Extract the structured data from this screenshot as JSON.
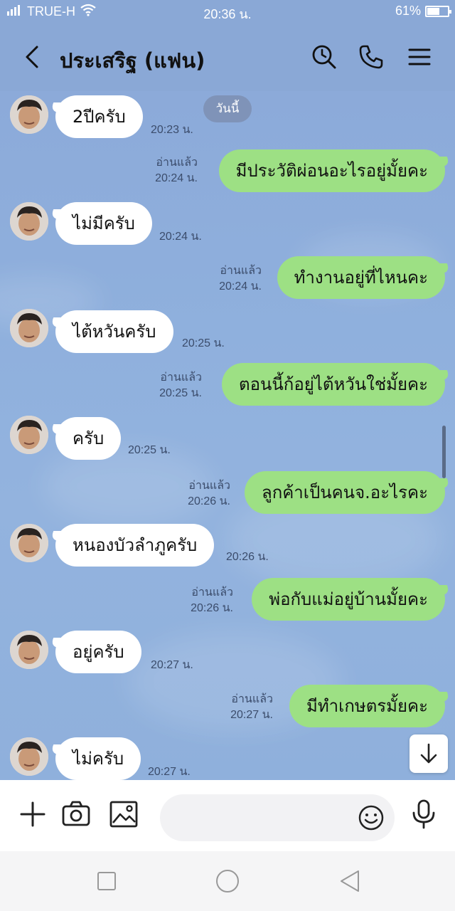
{
  "status_bar": {
    "carrier": "TRUE-H",
    "time": "20:36 น.",
    "battery": "61%",
    "battery_level": 0.61
  },
  "header": {
    "title": "ประเสริฐ (แฟน)"
  },
  "chat": {
    "date_label": "วันนี้",
    "read_label": "อ่านแล้ว",
    "messages": [
      {
        "text": "2ปีครับ",
        "time": "20:23 น."
      },
      {
        "text": "มีประวัติผ่อนอะไรอยู่มั้ยคะ",
        "time": "20:24 น."
      },
      {
        "text": "ไม่มีครับ",
        "time": "20:24 น."
      },
      {
        "text": "ทำงานอยู่ที่ไหนคะ",
        "time": "20:24 น."
      },
      {
        "text": "ไต้หวันครับ",
        "time": "20:25 น."
      },
      {
        "text": "ตอนนี้ก้อยู่ไต้หวันใช่มั้ยคะ",
        "time": "20:25 น."
      },
      {
        "text": "ครับ",
        "time": "20:25 น."
      },
      {
        "text": "ลูกค้าเป็นคนจ.อะไรคะ",
        "time": "20:26 น."
      },
      {
        "text": "หนองบัวลำภูครับ",
        "time": "20:26 น."
      },
      {
        "text": "พ่อกับแม่อยู่บ้านมั้ยคะ",
        "time": "20:26 น."
      },
      {
        "text": "อยู่ครับ",
        "time": "20:27 น."
      },
      {
        "text": "มีทำเกษตรมั้ยคะ",
        "time": "20:27 น."
      },
      {
        "text": "ไม่ครับ",
        "time": "20:27 น."
      }
    ]
  },
  "input": {
    "placeholder": ""
  },
  "colors": {
    "chat_bg": "#8caad9",
    "outgoing_bubble": "#9de084",
    "incoming_bubble": "#ffffff"
  }
}
